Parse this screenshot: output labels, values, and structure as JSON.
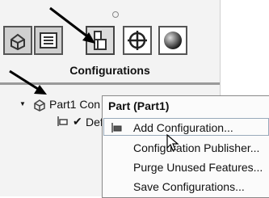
{
  "panel": {
    "heading": "Configurations",
    "tabs": [
      {
        "icon": "feature-manager-icon"
      },
      {
        "icon": "property-manager-icon"
      },
      {
        "icon": "configuration-manager-icon"
      },
      {
        "icon": "dimxpert-manager-icon"
      },
      {
        "icon": "display-manager-icon"
      }
    ],
    "tree": {
      "root_label": "Part1 Con",
      "child_label": "Def"
    }
  },
  "context_menu": {
    "title": "Part (Part1)",
    "items": [
      {
        "label": "Add Configuration..."
      },
      {
        "label": "Configuration Publisher..."
      },
      {
        "label": "Purge Unused Features..."
      },
      {
        "label": "Save Configurations..."
      }
    ]
  },
  "colors": {
    "panel_bg": "#f3f3f3",
    "tab_bg": "#cfcfcf",
    "menu_bg": "#fbfbfb"
  }
}
